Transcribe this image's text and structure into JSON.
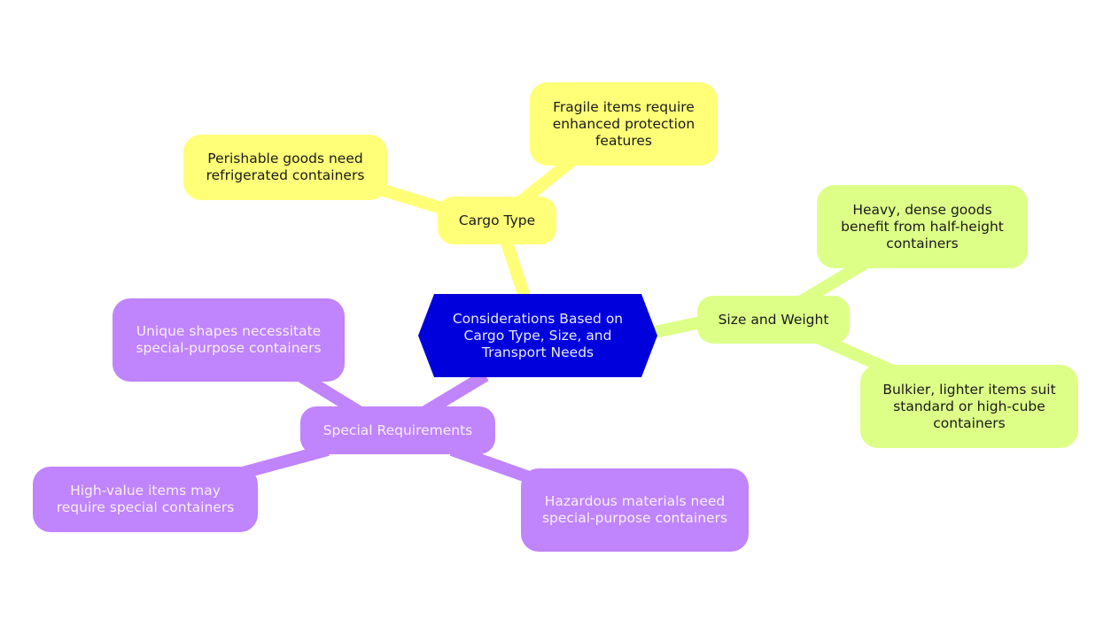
{
  "root": {
    "label": "Considerations Based on Cargo Type, Size, and Transport Needs",
    "color": "#0000dd"
  },
  "branches": [
    {
      "label": "Cargo Type",
      "color": "#ffff78",
      "children": [
        "Perishable goods need refrigerated containers",
        "Fragile items require enhanced protection features"
      ]
    },
    {
      "label": "Size and Weight",
      "color": "#ddff88",
      "children": [
        "Heavy, dense goods benefit from half-height containers",
        "Bulkier, lighter items suit standard or high-cube containers"
      ]
    },
    {
      "label": "Special Requirements",
      "color": "#c084fc",
      "children": [
        "Unique shapes necessitate special-purpose containers",
        "High-value items may require special containers",
        "Hazardous materials need special-purpose containers"
      ]
    }
  ]
}
